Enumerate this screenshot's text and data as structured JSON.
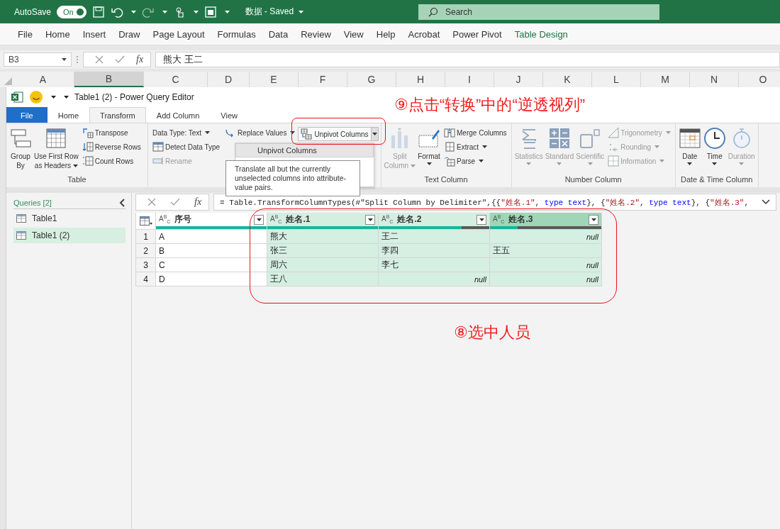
{
  "excel": {
    "autosave": {
      "label": "AutoSave",
      "on": true,
      "toggle_text": "On"
    },
    "title": "数据 - Saved",
    "search": {
      "placeholder": "Search"
    },
    "menu": [
      {
        "label": "File",
        "selected": false
      },
      {
        "label": "Home",
        "selected": false
      },
      {
        "label": "Insert",
        "selected": false
      },
      {
        "label": "Draw",
        "selected": false
      },
      {
        "label": "Page Layout",
        "selected": false
      },
      {
        "label": "Formulas",
        "selected": false
      },
      {
        "label": "Data",
        "selected": false
      },
      {
        "label": "Review",
        "selected": false
      },
      {
        "label": "View",
        "selected": false
      },
      {
        "label": "Help",
        "selected": false
      },
      {
        "label": "Acrobat",
        "selected": false
      },
      {
        "label": "Power Pivot",
        "selected": false
      },
      {
        "label": "Table Design",
        "selected": true
      }
    ],
    "name_box": "B3",
    "fx_label": "fx",
    "formula": "熊大 王二",
    "columns": [
      {
        "label": "A",
        "selected": false
      },
      {
        "label": "B",
        "selected": true
      },
      {
        "label": "C",
        "selected": false
      },
      {
        "label": "D",
        "selected": false
      },
      {
        "label": "E",
        "selected": false
      },
      {
        "label": "F",
        "selected": false
      },
      {
        "label": "G",
        "selected": false
      },
      {
        "label": "H",
        "selected": false
      },
      {
        "label": "I",
        "selected": false
      },
      {
        "label": "J",
        "selected": false
      },
      {
        "label": "K",
        "selected": false
      },
      {
        "label": "L",
        "selected": false
      },
      {
        "label": "M",
        "selected": false
      },
      {
        "label": "N",
        "selected": false
      },
      {
        "label": "O",
        "selected": false
      }
    ]
  },
  "power_query": {
    "title": "Table1 (2) - Power Query Editor",
    "tabs": [
      {
        "label": "File",
        "kind": "file",
        "selected": false
      },
      {
        "label": "Home",
        "kind": "tab",
        "selected": false
      },
      {
        "label": "Transform",
        "kind": "tab",
        "selected": true
      },
      {
        "label": "Add Column",
        "kind": "tab",
        "selected": false
      },
      {
        "label": "View",
        "kind": "tab",
        "selected": false
      }
    ],
    "ribbon_groups": [
      {
        "label": "Table",
        "items": [
          {
            "kind": "large",
            "label": "Group\nBy",
            "dropdown": false,
            "disabled": false
          },
          {
            "kind": "large",
            "label": "Use First Row\nas Headers",
            "dropdown": true,
            "disabled": false
          },
          {
            "kind": "small",
            "label": "Transpose",
            "dropdown": false,
            "disabled": false
          },
          {
            "kind": "small",
            "label": "Reverse Rows",
            "dropdown": false,
            "disabled": false
          },
          {
            "kind": "small",
            "label": "Count Rows",
            "dropdown": false,
            "disabled": false
          }
        ]
      },
      {
        "items": [
          {
            "kind": "small",
            "label": "Data Type: Text",
            "dropdown": true,
            "disabled": false
          },
          {
            "kind": "small",
            "label": "Detect Data Type",
            "dropdown": false,
            "disabled": false
          },
          {
            "kind": "small",
            "label": "Rename",
            "dropdown": false,
            "disabled": true
          },
          {
            "kind": "small",
            "label": "Replace Values",
            "dropdown": true,
            "disabled": false
          },
          {
            "kind": "split",
            "label": "Unpivot Columns",
            "dropdown": true,
            "disabled": false
          }
        ]
      },
      {
        "label": "Text Column",
        "items": [
          {
            "kind": "large",
            "label": "Split\nColumn",
            "dropdown": true,
            "disabled": true
          },
          {
            "kind": "large",
            "label": "Format",
            "dropdown": true,
            "disabled": false
          },
          {
            "kind": "small",
            "label": "Merge Columns",
            "dropdown": false,
            "disabled": false
          },
          {
            "kind": "small",
            "label": "Extract",
            "dropdown": true,
            "disabled": false
          },
          {
            "kind": "small",
            "label": "Parse",
            "dropdown": true,
            "disabled": false
          }
        ]
      },
      {
        "label": "Number Column",
        "items": [
          {
            "kind": "large",
            "label": "Statistics",
            "dropdown": true,
            "disabled": true
          },
          {
            "kind": "large",
            "label": "Standard",
            "dropdown": true,
            "disabled": true
          },
          {
            "kind": "large",
            "label": "Scientific",
            "dropdown": true,
            "disabled": true
          },
          {
            "kind": "small",
            "label": "Trigonometry",
            "dropdown": true,
            "disabled": true
          },
          {
            "kind": "small",
            "label": "Rounding",
            "dropdown": true,
            "disabled": true
          },
          {
            "kind": "small",
            "label": "Information",
            "dropdown": true,
            "disabled": true
          }
        ]
      },
      {
        "label": "Date & Time Column",
        "items": [
          {
            "kind": "large",
            "label": "Date",
            "dropdown": true,
            "disabled": false
          },
          {
            "kind": "large",
            "label": "Time",
            "dropdown": true,
            "disabled": false
          },
          {
            "kind": "large",
            "label": "Duration",
            "dropdown": true,
            "disabled": true
          }
        ]
      }
    ],
    "dropdown_menu": {
      "items": [
        {
          "label": "Unpivot Columns",
          "selected": true
        }
      ]
    },
    "tooltip": "Translate all but the currently unselected columns into attribute-value pairs.",
    "queries": {
      "header": "Queries [2]",
      "items": [
        {
          "label": "Table1",
          "selected": false
        },
        {
          "label": "Table1 (2)",
          "selected": true
        }
      ]
    },
    "formula_bar": {
      "fx_label": "fx",
      "segments": [
        {
          "kind": "plain",
          "text": "= Table.TransformColumnTypes(#\"Split Column by Delimiter\",{{"
        },
        {
          "kind": "string",
          "text": "\"姓名.1\""
        },
        {
          "kind": "plain",
          "text": ", "
        },
        {
          "kind": "keyword",
          "text": "type text"
        },
        {
          "kind": "plain",
          "text": "}, {"
        },
        {
          "kind": "string",
          "text": "\"姓名.2\""
        },
        {
          "kind": "plain",
          "text": ", "
        },
        {
          "kind": "keyword",
          "text": "type text"
        },
        {
          "kind": "plain",
          "text": "}, {"
        },
        {
          "kind": "string",
          "text": "\"姓名.3\""
        },
        {
          "kind": "plain",
          "text": ","
        }
      ]
    },
    "table": {
      "columns": [
        {
          "name": "序号",
          "type_label": "A$^{B}$$_{C}$",
          "selected": false,
          "active": false,
          "level": 1
        },
        {
          "name": "姓名.1",
          "type_label": "A$^{B}$$_{C}$",
          "selected": true,
          "active": false,
          "level": 1
        },
        {
          "name": "姓名.2",
          "type_label": "A$^{B}$$_{C}$",
          "selected": true,
          "active": false,
          "level": 0.75
        },
        {
          "name": "姓名.3",
          "type_label": "A$^{B}$$_{C}$",
          "selected": true,
          "active": true,
          "level": 0.25
        }
      ],
      "rows": [
        {
          "index": "1",
          "cells": [
            {
              "kind": "text",
              "text": "A"
            },
            {
              "kind": "text",
              "text": "熊大"
            },
            {
              "kind": "text",
              "text": "王二"
            },
            {
              "kind": "null",
              "text": "null"
            }
          ]
        },
        {
          "index": "2",
          "cells": [
            {
              "kind": "text",
              "text": "B"
            },
            {
              "kind": "text",
              "text": "张三"
            },
            {
              "kind": "text",
              "text": "李四"
            },
            {
              "kind": "text",
              "text": "王五"
            }
          ]
        },
        {
          "index": "3",
          "cells": [
            {
              "kind": "text",
              "text": "C"
            },
            {
              "kind": "text",
              "text": "周六"
            },
            {
              "kind": "text",
              "text": "李七"
            },
            {
              "kind": "null",
              "text": "null"
            }
          ]
        },
        {
          "index": "4",
          "cells": [
            {
              "kind": "text",
              "text": "D"
            },
            {
              "kind": "text",
              "text": "王八"
            },
            {
              "kind": "null",
              "text": "null"
            },
            {
              "kind": "null",
              "text": "null"
            }
          ]
        }
      ]
    }
  },
  "annotations": [
    {
      "text": "⑨点击“转换”中的“逆透视列”"
    },
    {
      "text": "⑧选中人员"
    }
  ]
}
